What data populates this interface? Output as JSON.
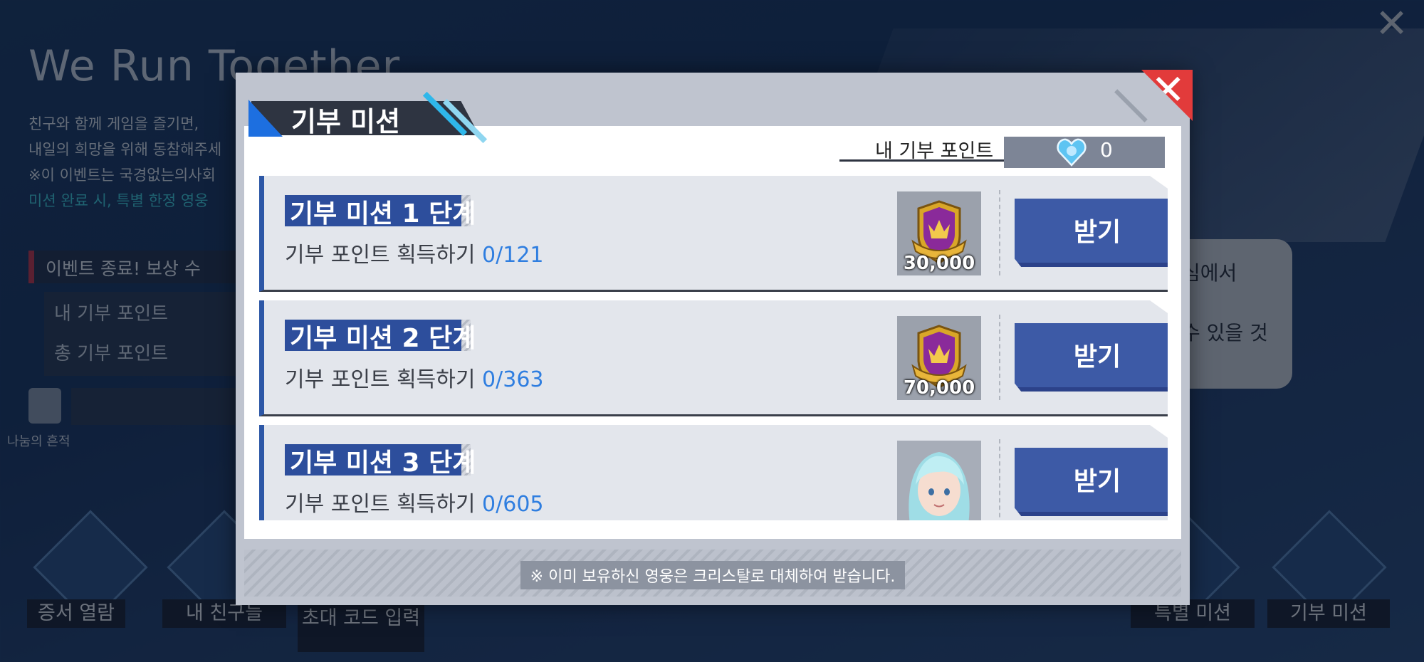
{
  "background": {
    "title": "We Run Together",
    "desc_lines": [
      "친구와 함께 게임을 즐기면,",
      "내일의 희망을 위해 동참해주세",
      "※이 이벤트는 국경없는의사회",
      "미션 완료 시, 특별 한정 영웅"
    ],
    "event_end": "이벤트 종료! 보상 수",
    "my_points_label": "내 기부 포인트",
    "total_points_label": "총 기부 포인트",
    "sharing_label": "나눔의 흔적",
    "right_text_1": "심에서",
    "right_text_2": "수 있을 것",
    "bottom_buttons": [
      "증서 열람",
      "내 친구들",
      "초대 코드 입력",
      "특별 미션",
      "기부 미션"
    ]
  },
  "modal": {
    "title": "기부 미션",
    "points_label": "내 기부 포인트",
    "points_value": "0",
    "footer_note": "※ 이미 보유하신 영웅은 크리스탈로 대체하여 받습니다.",
    "missions": [
      {
        "title": "기부 미션 1 단계",
        "desc": "기부 포인트 획득하기",
        "progress": "0/121",
        "reward_qty": "30,000",
        "button": "받기"
      },
      {
        "title": "기부 미션 2 단계",
        "desc": "기부 포인트 획득하기",
        "progress": "0/363",
        "reward_qty": "70,000",
        "button": "받기"
      },
      {
        "title": "기부 미션 3 단계",
        "desc": "기부 포인트 획득하기",
        "progress": "0/605",
        "reward_qty": "",
        "button": "받기"
      }
    ]
  },
  "colors": {
    "accent_blue": "#3d5aa6",
    "progress_blue": "#2f7ee0",
    "close_red": "#e23b3b"
  },
  "icons": {
    "close": "close-icon",
    "points": "heart-gem-icon",
    "reward": "gold-crest-icon",
    "hero": "hero-portrait-icon"
  }
}
